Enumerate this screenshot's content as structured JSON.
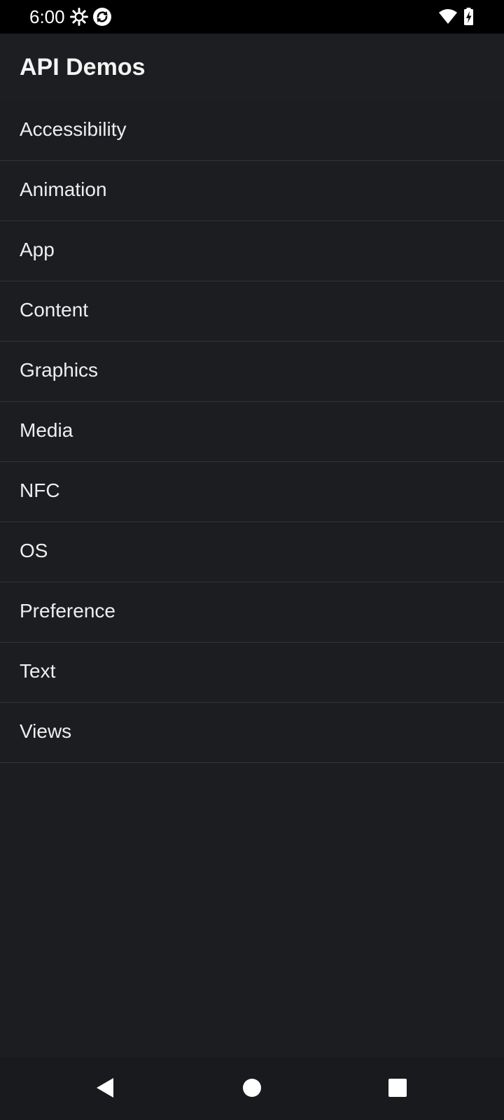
{
  "status_bar": {
    "time": "6:00",
    "icons": [
      "settings-gear-icon",
      "sync-icon",
      "wifi-icon",
      "battery-charging-icon"
    ]
  },
  "app_bar": {
    "title": "API Demos"
  },
  "list": {
    "items": [
      {
        "label": "Accessibility"
      },
      {
        "label": "Animation"
      },
      {
        "label": "App"
      },
      {
        "label": "Content"
      },
      {
        "label": "Graphics"
      },
      {
        "label": "Media"
      },
      {
        "label": "NFC"
      },
      {
        "label": "OS"
      },
      {
        "label": "Preference"
      },
      {
        "label": "Text"
      },
      {
        "label": "Views"
      }
    ]
  },
  "nav_bar": {
    "buttons": [
      "back-icon",
      "home-icon",
      "recents-icon"
    ]
  },
  "colors": {
    "background": "#1b1d20",
    "status_bar": "#000000",
    "divider": "#30343a",
    "text": "#eeeeee"
  }
}
